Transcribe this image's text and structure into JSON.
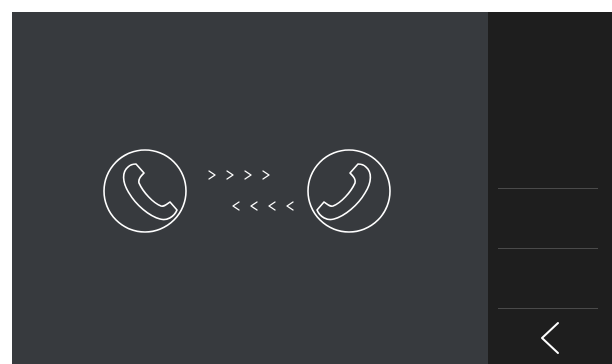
{
  "screen": {
    "main_bg": "#373a3e",
    "sidebar_bg": "#1e1e1e",
    "icon_color": "#ffffff",
    "divider_color": "#4a4a4a"
  },
  "diagram": {
    "left_icon": "phone-handset-icon",
    "right_icon": "phone-handset-icon",
    "outgoing_arrows": "> > > >",
    "incoming_arrows": "< < < <"
  },
  "sidebar": {
    "back_icon": "chevron-left-icon"
  }
}
